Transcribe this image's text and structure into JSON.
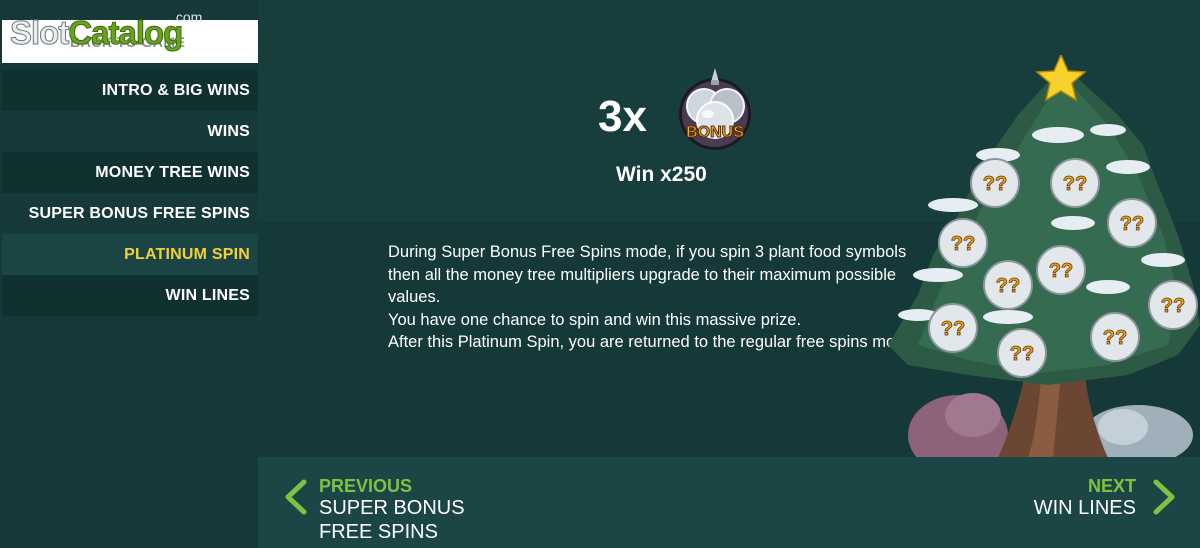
{
  "logo": {
    "part1": "Slot",
    "part2": "Catalog",
    "suffix": ".com"
  },
  "back_button": {
    "label": "BACK TO GAME"
  },
  "menu": {
    "items": [
      {
        "label": "INTRO & BIG WINS",
        "active": false
      },
      {
        "label": "WINS",
        "active": false
      },
      {
        "label": "MONEY TREE WINS",
        "active": false
      },
      {
        "label": "SUPER BONUS FREE SPINS",
        "active": false
      },
      {
        "label": "PLATINUM SPIN",
        "active": true
      },
      {
        "label": "WIN LINES",
        "active": false
      }
    ]
  },
  "main": {
    "multiplier": "3x",
    "symbol_label": "BONUS",
    "win": "Win x250",
    "description": [
      "During Super Bonus Free Spins mode, if you spin 3 plant food symbols then all the money tree multipliers upgrade to their maximum possible values.",
      "You have one chance to spin and win this massive prize.",
      "After this Platinum Spin, you are returned to the regular free spins mode."
    ],
    "ornament_label": "??"
  },
  "nav": {
    "previous_title": "PREVIOUS",
    "previous_target": "SUPER BONUS FREE SPINS",
    "next_title": "NEXT",
    "next_target": "WIN LINES"
  },
  "colors": {
    "background": "#153838",
    "active_menu": "#f3d033",
    "nav_accent": "#7cc243",
    "logo_green": "#6aa41c"
  }
}
